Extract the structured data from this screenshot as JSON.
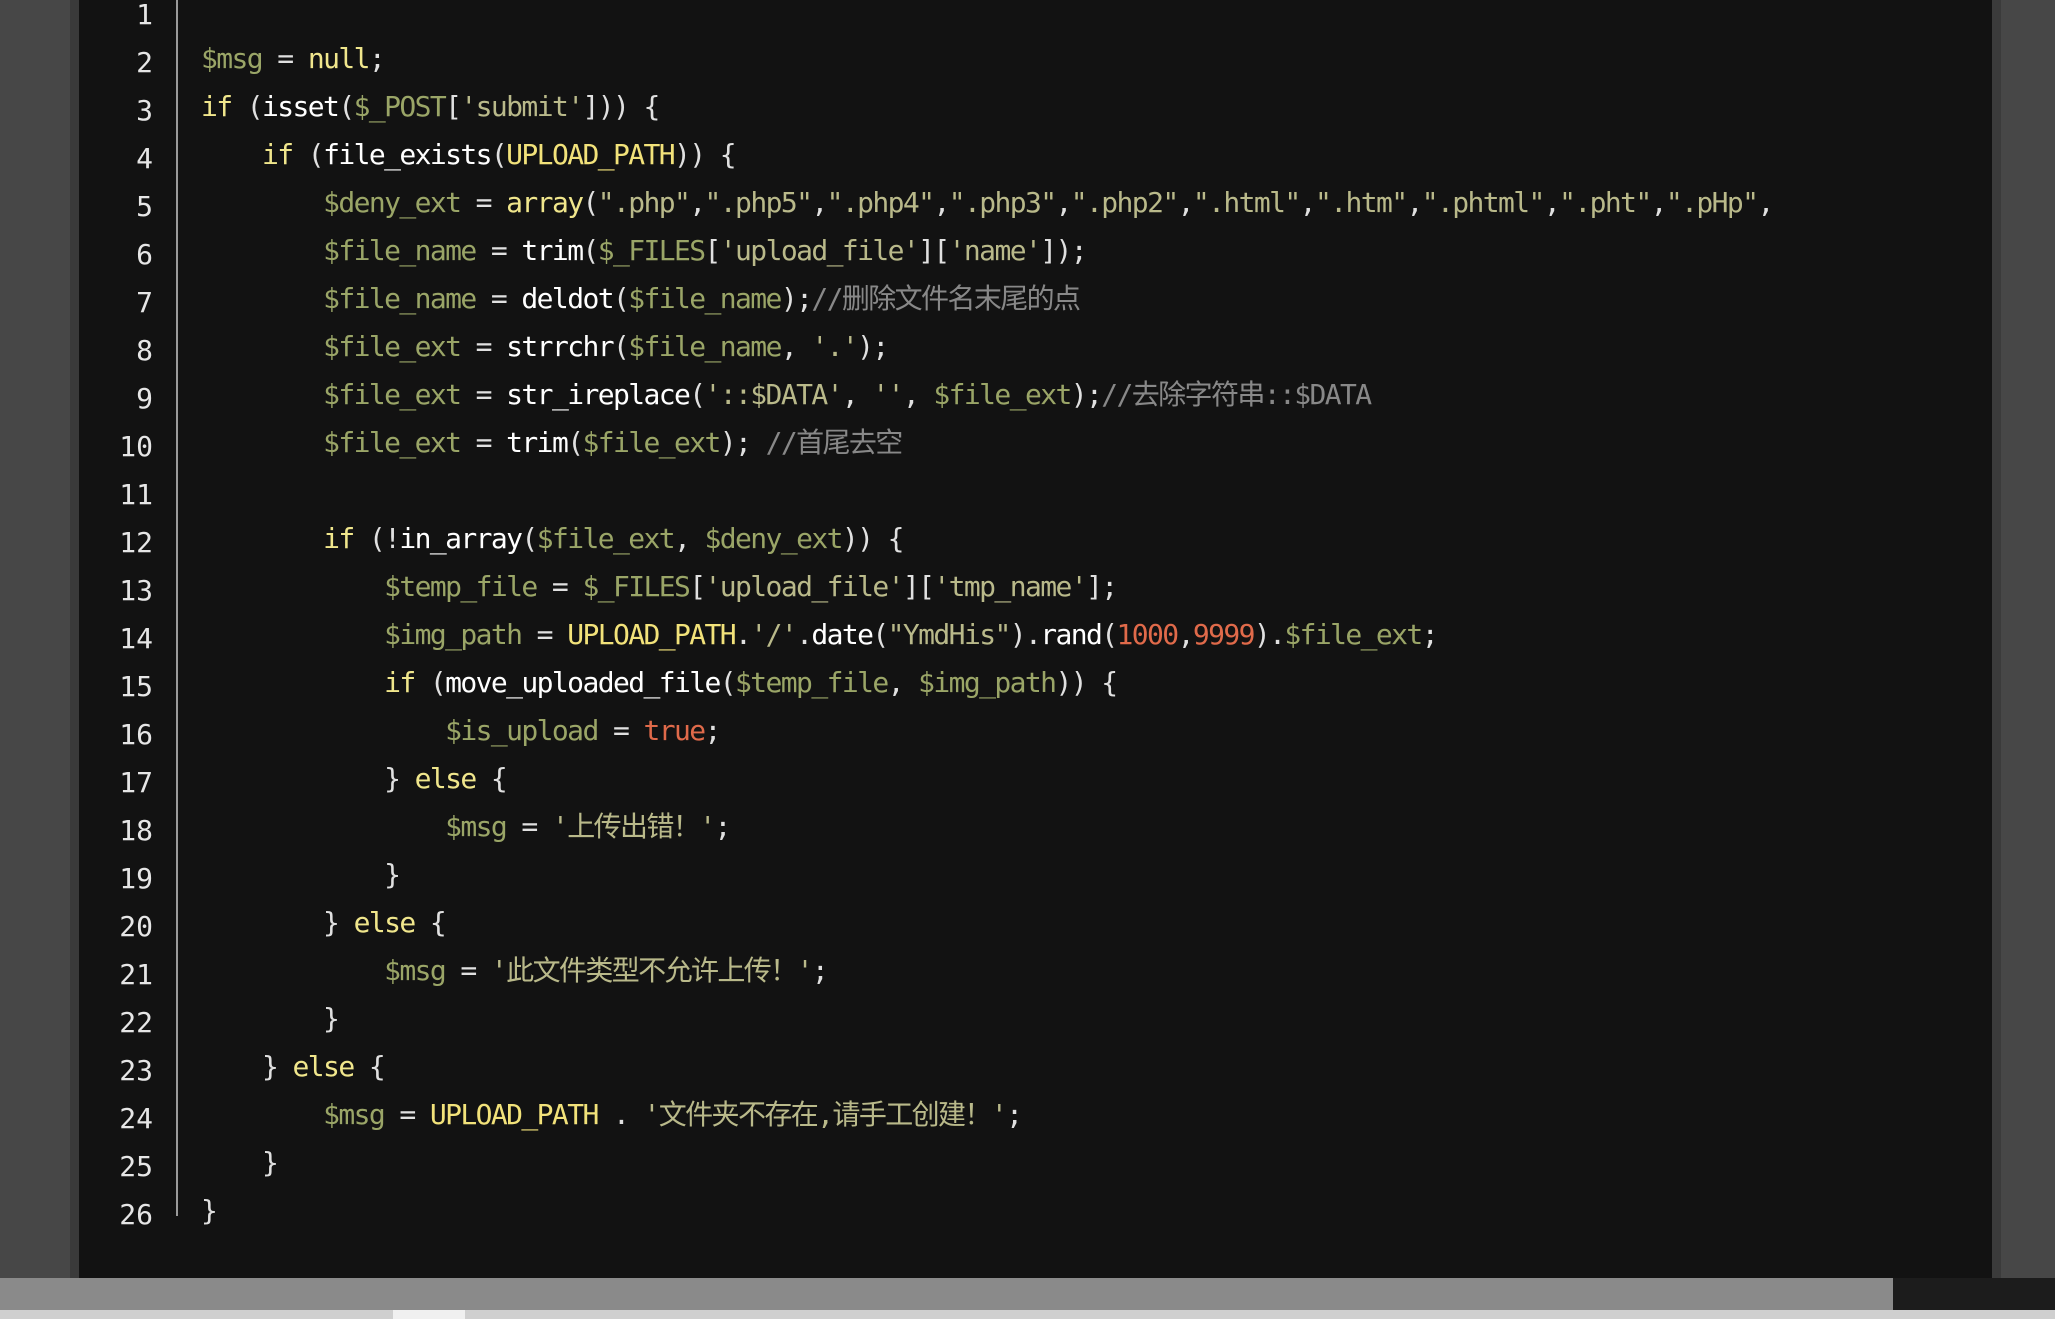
{
  "editor": {
    "lines": [
      {
        "n": "1",
        "tokens": []
      },
      {
        "n": "2",
        "tokens": [
          [
            "var",
            "$msg"
          ],
          [
            "pn",
            " = "
          ],
          [
            "kw",
            "null"
          ],
          [
            "pn",
            ";"
          ]
        ]
      },
      {
        "n": "3",
        "tokens": [
          [
            "kw",
            "if"
          ],
          [
            "pn",
            " ("
          ],
          [
            "fn",
            "isset"
          ],
          [
            "pn",
            "("
          ],
          [
            "var",
            "$_POST"
          ],
          [
            "pn",
            "["
          ],
          [
            "str",
            "'submit'"
          ],
          [
            "pn",
            "])) {"
          ]
        ]
      },
      {
        "n": "4",
        "tokens": [
          [
            "pn",
            "    "
          ],
          [
            "kw",
            "if"
          ],
          [
            "pn",
            " ("
          ],
          [
            "fn",
            "file_exists"
          ],
          [
            "pn",
            "("
          ],
          [
            "const",
            "UPLOAD_PATH"
          ],
          [
            "pn",
            ")) {"
          ]
        ]
      },
      {
        "n": "5",
        "tokens": [
          [
            "pn",
            "        "
          ],
          [
            "var",
            "$deny_ext"
          ],
          [
            "pn",
            " = "
          ],
          [
            "kw",
            "array"
          ],
          [
            "pn",
            "("
          ],
          [
            "str",
            "\".php\""
          ],
          [
            "pn",
            ","
          ],
          [
            "str",
            "\".php5\""
          ],
          [
            "pn",
            ","
          ],
          [
            "str",
            "\".php4\""
          ],
          [
            "pn",
            ","
          ],
          [
            "str",
            "\".php3\""
          ],
          [
            "pn",
            ","
          ],
          [
            "str",
            "\".php2\""
          ],
          [
            "pn",
            ","
          ],
          [
            "str",
            "\".html\""
          ],
          [
            "pn",
            ","
          ],
          [
            "str",
            "\".htm\""
          ],
          [
            "pn",
            ","
          ],
          [
            "str",
            "\".phtml\""
          ],
          [
            "pn",
            ","
          ],
          [
            "str",
            "\".pht\""
          ],
          [
            "pn",
            ","
          ],
          [
            "str",
            "\".pHp\""
          ],
          [
            "pn",
            ","
          ]
        ]
      },
      {
        "n": "6",
        "tokens": [
          [
            "pn",
            "        "
          ],
          [
            "var",
            "$file_name"
          ],
          [
            "pn",
            " = "
          ],
          [
            "fn",
            "trim"
          ],
          [
            "pn",
            "("
          ],
          [
            "var",
            "$_FILES"
          ],
          [
            "pn",
            "["
          ],
          [
            "str",
            "'upload_file'"
          ],
          [
            "pn",
            "]["
          ],
          [
            "str",
            "'name'"
          ],
          [
            "pn",
            "]);"
          ]
        ]
      },
      {
        "n": "7",
        "tokens": [
          [
            "pn",
            "        "
          ],
          [
            "var",
            "$file_name"
          ],
          [
            "pn",
            " = "
          ],
          [
            "fn",
            "deldot"
          ],
          [
            "pn",
            "("
          ],
          [
            "var",
            "$file_name"
          ],
          [
            "pn",
            ");"
          ],
          [
            "cmt",
            "//删除文件名末尾的点"
          ]
        ]
      },
      {
        "n": "8",
        "tokens": [
          [
            "pn",
            "        "
          ],
          [
            "var",
            "$file_ext"
          ],
          [
            "pn",
            " = "
          ],
          [
            "fn",
            "strrchr"
          ],
          [
            "pn",
            "("
          ],
          [
            "var",
            "$file_name"
          ],
          [
            "pn",
            ", "
          ],
          [
            "str",
            "'.'"
          ],
          [
            "pn",
            ");"
          ]
        ]
      },
      {
        "n": "9",
        "tokens": [
          [
            "pn",
            "        "
          ],
          [
            "var",
            "$file_ext"
          ],
          [
            "pn",
            " = "
          ],
          [
            "fn",
            "str_ireplace"
          ],
          [
            "pn",
            "("
          ],
          [
            "str",
            "'::$DATA'"
          ],
          [
            "pn",
            ", "
          ],
          [
            "str",
            "''"
          ],
          [
            "pn",
            ", "
          ],
          [
            "var",
            "$file_ext"
          ],
          [
            "pn",
            ");"
          ],
          [
            "cmt",
            "//去除字符串::$DATA"
          ]
        ]
      },
      {
        "n": "10",
        "tokens": [
          [
            "pn",
            "        "
          ],
          [
            "var",
            "$file_ext"
          ],
          [
            "pn",
            " = "
          ],
          [
            "fn",
            "trim"
          ],
          [
            "pn",
            "("
          ],
          [
            "var",
            "$file_ext"
          ],
          [
            "pn",
            "); "
          ],
          [
            "cmt",
            "//首尾去空"
          ]
        ]
      },
      {
        "n": "11",
        "tokens": []
      },
      {
        "n": "12",
        "tokens": [
          [
            "pn",
            "        "
          ],
          [
            "kw",
            "if"
          ],
          [
            "pn",
            " (!"
          ],
          [
            "fn",
            "in_array"
          ],
          [
            "pn",
            "("
          ],
          [
            "var",
            "$file_ext"
          ],
          [
            "pn",
            ", "
          ],
          [
            "var",
            "$deny_ext"
          ],
          [
            "pn",
            ")) {"
          ]
        ]
      },
      {
        "n": "13",
        "tokens": [
          [
            "pn",
            "            "
          ],
          [
            "var",
            "$temp_file"
          ],
          [
            "pn",
            " = "
          ],
          [
            "var",
            "$_FILES"
          ],
          [
            "pn",
            "["
          ],
          [
            "str",
            "'upload_file'"
          ],
          [
            "pn",
            "]["
          ],
          [
            "str",
            "'tmp_name'"
          ],
          [
            "pn",
            "];"
          ]
        ]
      },
      {
        "n": "14",
        "tokens": [
          [
            "pn",
            "            "
          ],
          [
            "var",
            "$img_path"
          ],
          [
            "pn",
            " = "
          ],
          [
            "const",
            "UPLOAD_PATH"
          ],
          [
            "pn",
            "."
          ],
          [
            "str",
            "'/'"
          ],
          [
            "pn",
            "."
          ],
          [
            "fn",
            "date"
          ],
          [
            "pn",
            "("
          ],
          [
            "str",
            "\"YmdHis\""
          ],
          [
            "pn",
            ")."
          ],
          [
            "fn",
            "rand"
          ],
          [
            "pn",
            "("
          ],
          [
            "num",
            "1000"
          ],
          [
            "pn",
            ","
          ],
          [
            "num",
            "9999"
          ],
          [
            "pn",
            ")."
          ],
          [
            "var",
            "$file_ext"
          ],
          [
            "pn",
            ";"
          ]
        ]
      },
      {
        "n": "15",
        "tokens": [
          [
            "pn",
            "            "
          ],
          [
            "kw",
            "if"
          ],
          [
            "pn",
            " ("
          ],
          [
            "fn",
            "move_uploaded_file"
          ],
          [
            "pn",
            "("
          ],
          [
            "var",
            "$temp_file"
          ],
          [
            "pn",
            ", "
          ],
          [
            "var",
            "$img_path"
          ],
          [
            "pn",
            ")) {"
          ]
        ]
      },
      {
        "n": "16",
        "tokens": [
          [
            "pn",
            "                "
          ],
          [
            "var",
            "$is_upload"
          ],
          [
            "pn",
            " = "
          ],
          [
            "num",
            "true"
          ],
          [
            "pn",
            ";"
          ]
        ]
      },
      {
        "n": "17",
        "tokens": [
          [
            "pn",
            "            } "
          ],
          [
            "kw",
            "else"
          ],
          [
            "pn",
            " {"
          ]
        ]
      },
      {
        "n": "18",
        "tokens": [
          [
            "pn",
            "                "
          ],
          [
            "var",
            "$msg"
          ],
          [
            "pn",
            " = "
          ],
          [
            "str",
            "'上传出错！'"
          ],
          [
            "pn",
            ";"
          ]
        ]
      },
      {
        "n": "19",
        "tokens": [
          [
            "pn",
            "            }"
          ]
        ]
      },
      {
        "n": "20",
        "tokens": [
          [
            "pn",
            "        } "
          ],
          [
            "kw",
            "else"
          ],
          [
            "pn",
            " {"
          ]
        ]
      },
      {
        "n": "21",
        "tokens": [
          [
            "pn",
            "            "
          ],
          [
            "var",
            "$msg"
          ],
          [
            "pn",
            " = "
          ],
          [
            "str",
            "'此文件类型不允许上传！'"
          ],
          [
            "pn",
            ";"
          ]
        ]
      },
      {
        "n": "22",
        "tokens": [
          [
            "pn",
            "        }"
          ]
        ]
      },
      {
        "n": "23",
        "tokens": [
          [
            "pn",
            "    } "
          ],
          [
            "kw",
            "else"
          ],
          [
            "pn",
            " {"
          ]
        ]
      },
      {
        "n": "24",
        "tokens": [
          [
            "pn",
            "        "
          ],
          [
            "var",
            "$msg"
          ],
          [
            "pn",
            " = "
          ],
          [
            "const",
            "UPLOAD_PATH"
          ],
          [
            "pn",
            " . "
          ],
          [
            "str",
            "'文件夹不存在,请手工创建！'"
          ],
          [
            "pn",
            ";"
          ]
        ]
      },
      {
        "n": "25",
        "tokens": [
          [
            "pn",
            "    }"
          ]
        ]
      },
      {
        "n": "26",
        "tokens": [
          [
            "pn",
            "}"
          ]
        ]
      }
    ]
  },
  "colors": {
    "background": "#121212",
    "keyword": "#f0e68c",
    "variable": "#9aa567",
    "string": "#b9b98a",
    "function": "#ffffff",
    "constant": "#f2e27a",
    "number": "#e06a4a",
    "comment": "#888888"
  }
}
